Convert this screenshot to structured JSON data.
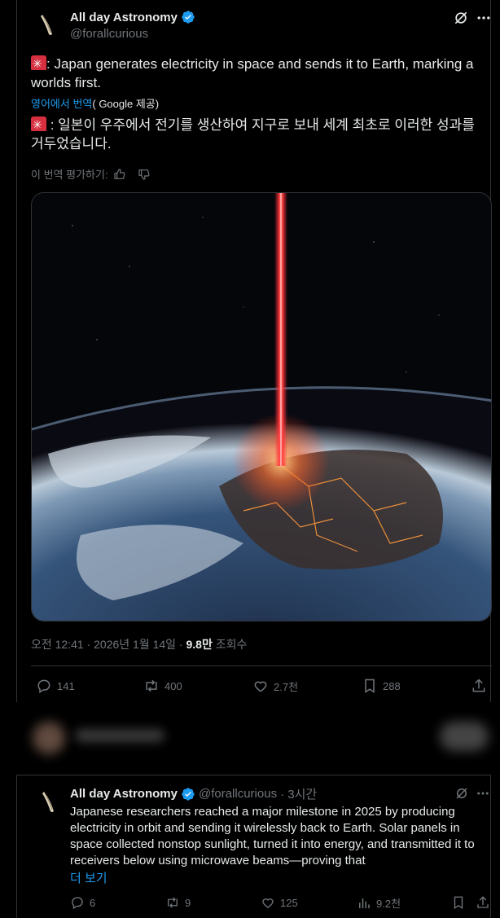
{
  "tweet": {
    "author_name": "All day Astronomy",
    "handle": "@forallcurious",
    "text_en": ": Japan generates electricity in space and sends it to Earth, marking a worlds first.",
    "translate_source_link": "영어에서 번역",
    "translate_source_suffix": "( Google 제공)",
    "text_ko": " : 일본이 우주에서 전기를 생산하여 지구로 보내 세계 최초로 이러한 성과를 거두었습니다.",
    "rate_label": "이 번역 평가하기:",
    "time": "오전 12:41 · 2026년 1월 14일 · ",
    "views": "9.8만",
    "views_label": " 조회수",
    "replies": "141",
    "retweets": "400",
    "likes": "2.7천",
    "bookmarks": "288"
  },
  "reply": {
    "author_name": "All day Astronomy",
    "handle": "@forallcurious",
    "time": " · 3시간",
    "text": "Japanese researchers reached a major milestone in 2025 by producing electricity in orbit and sending it wirelessly back to Earth. Solar panels in space collected nonstop sunlight, turned it into energy, and transmitted it to receivers below using microwave beams—proving that",
    "more_label": "더 보기",
    "replies": "6",
    "retweets": "9",
    "likes": "125",
    "views": "9.2천"
  },
  "colors": {
    "accent": "#1d9bf0",
    "muted": "#71767b",
    "text": "#e7e9ea",
    "beam": "#ff2a3a"
  },
  "icons": [
    "grok-icon",
    "more-icon",
    "verified-icon",
    "thumbs-up-icon",
    "thumbs-down-icon",
    "reply-icon",
    "retweet-icon",
    "like-icon",
    "bookmark-icon",
    "share-icon",
    "views-icon"
  ]
}
